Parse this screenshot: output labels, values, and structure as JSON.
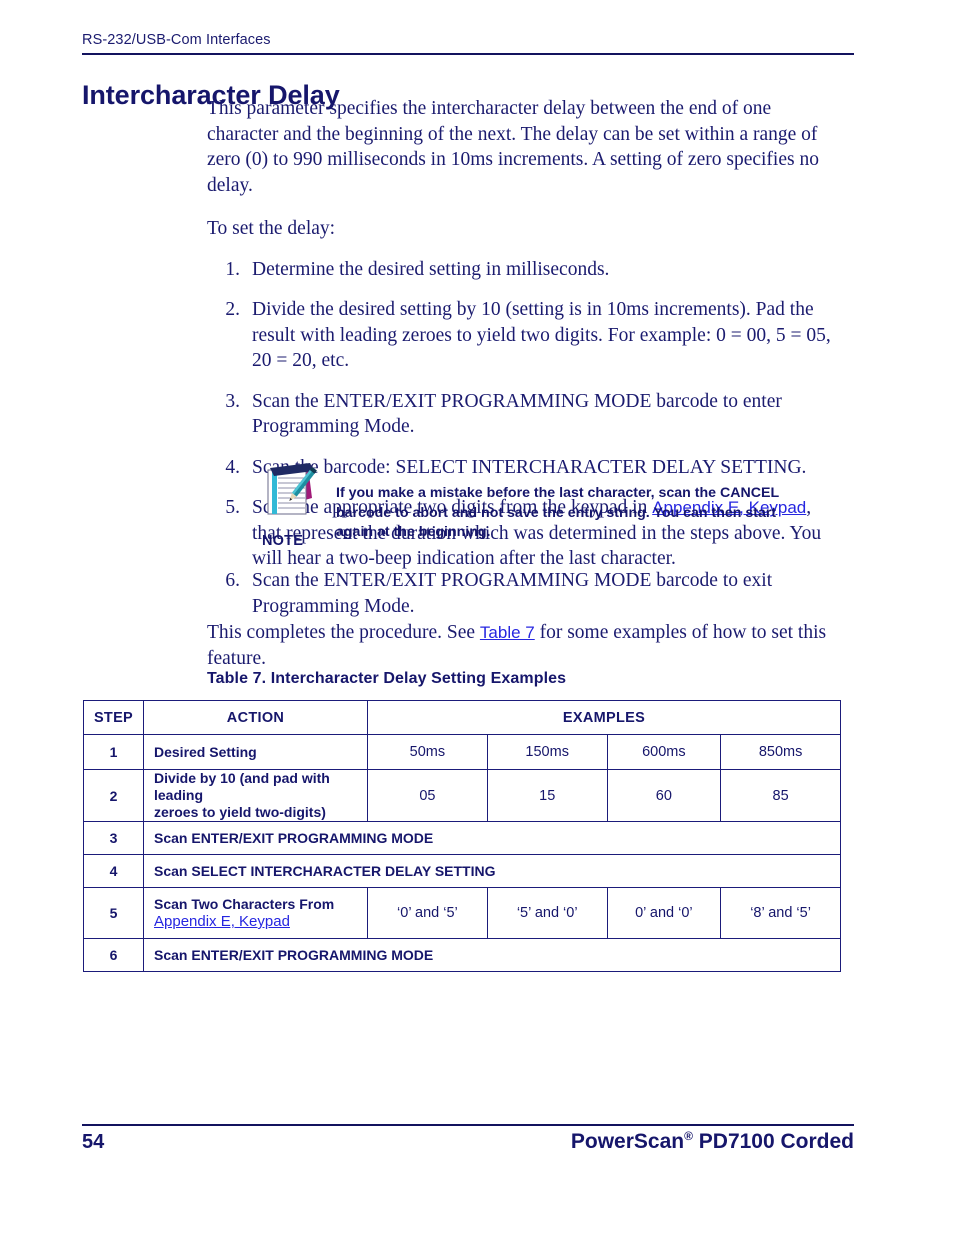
{
  "header": {
    "running_head": "RS-232/USB-Com Interfaces",
    "title": "Intercharacter Delay"
  },
  "body": {
    "intro": "This parameter specifies the intercharacter delay between the end of one character and the beginning of the next. The delay can be set within a range of zero (0) to 990 milliseconds in 10ms increments. A setting of zero specifies no delay.",
    "lead_in": "To set the delay:",
    "steps": [
      {
        "num": "1.",
        "text": "Determine the desired setting in milliseconds."
      },
      {
        "num": "2.",
        "text": "Divide the desired setting by 10 (setting is in 10ms increments). Pad the result with leading zeroes to yield two digits. For example: 0 = 00, 5 = 05, 20 = 20, etc."
      },
      {
        "num": "3.",
        "text": "Scan the ENTER/EXIT PROGRAMMING MODE barcode to enter Programming Mode."
      },
      {
        "num": "4.",
        "text": "Scan the barcode: SELECT INTERCHARACTER DELAY SETTING."
      },
      {
        "num": "5.",
        "text_before_link": "Scan the appropriate two digits from the keypad in ",
        "link": "Appendix E, Keypad",
        "text_after_link": ", that represent the duration which was determined in the steps above. You will hear a two-beep indication after the last character."
      }
    ],
    "step6": {
      "num": "6.",
      "text": "Scan the ENTER/EXIT PROGRAMMING MODE barcode to exit Programming Mode."
    },
    "closing_before_link": "This completes the procedure. See ",
    "closing_link": "Table 7",
    "closing_after_link": " for some examples of how to set this feature."
  },
  "note": {
    "label": "NOTE",
    "text": "If you make a mistake before the last character, scan the CANCEL barcode to abort and not save the entry string. You can then start again at the beginning."
  },
  "table": {
    "caption": "Table 7. Intercharacter Delay Setting Examples",
    "headers": {
      "step": "STEP",
      "action": "ACTION",
      "examples": "EXAMPLES"
    },
    "rows": [
      {
        "step": "1",
        "action": "Desired Setting",
        "examples": [
          "50ms",
          "150ms",
          "600ms",
          "850ms"
        ]
      },
      {
        "step": "2",
        "action_line1": "Divide by 10 (and pad with leading",
        "action_line2": "zeroes to yield two-digits)",
        "examples": [
          "05",
          "15",
          "60",
          "85"
        ]
      },
      {
        "step": "3",
        "action": "Scan ENTER/EXIT PROGRAMMING MODE",
        "full_width": true
      },
      {
        "step": "4",
        "action": "Scan SELECT INTERCHARACTER DELAY SETTING",
        "full_width": true
      },
      {
        "step": "5",
        "action_line1": "Scan Two Characters From",
        "action_link": "Appendix E, Keypad",
        "examples": [
          "‘0’ and ‘5’",
          "‘5’ and ‘0’",
          "0’ and ‘0’",
          "‘8’ and ‘5’"
        ]
      },
      {
        "step": "6",
        "action": "Scan ENTER/EXIT PROGRAMMING MODE",
        "full_width": true
      }
    ]
  },
  "footer": {
    "page_number": "54",
    "product_name_1": "PowerScan",
    "registered_mark": "®",
    "product_name_2": " PD7100 Corded"
  },
  "colors": {
    "navy": "#16166b",
    "body_navy": "#1b1b6f",
    "link_blue": "#2626e0",
    "rule": "#13135e"
  }
}
